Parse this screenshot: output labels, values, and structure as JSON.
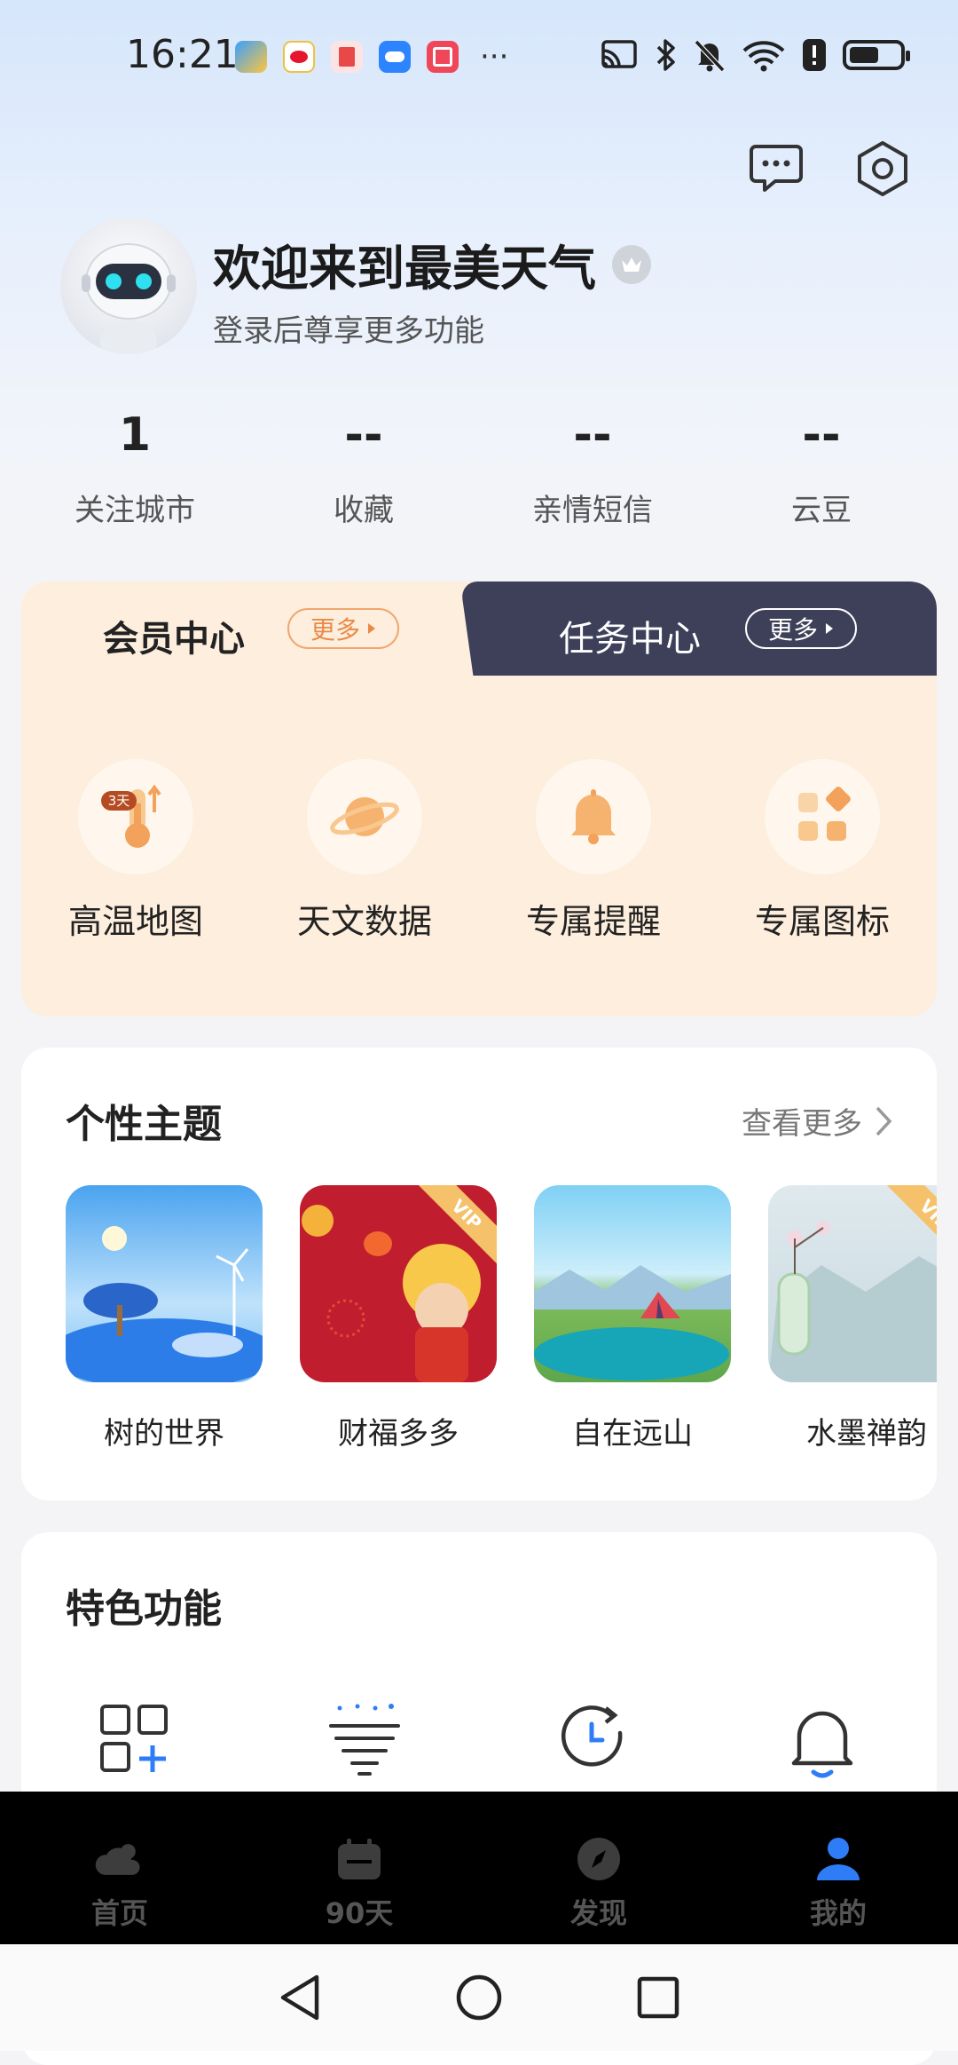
{
  "status_bar": {
    "time": "16:21",
    "more": "···",
    "notification_icons": [
      "weather-app-icon",
      "weibo-icon",
      "reader-app-icon",
      "cloud-app-icon",
      "gift-app-icon"
    ],
    "system_icons": [
      "cast-icon",
      "bluetooth-icon",
      "mute-icon",
      "wifi-icon",
      "alert-icon",
      "battery-icon"
    ]
  },
  "profile": {
    "welcome": "欢迎来到最美天气",
    "login_hint": "登录后尊享更多功能"
  },
  "stats": [
    {
      "value": "1",
      "label": "关注城市"
    },
    {
      "value": "--",
      "label": "收藏"
    },
    {
      "value": "--",
      "label": "亲情短信"
    },
    {
      "value": "--",
      "label": "云豆"
    }
  ],
  "member_card": {
    "member_tab": "会员中心",
    "member_more": "更多",
    "task_tab": "任务中心",
    "task_more": "更多",
    "badge": "3天",
    "items": [
      {
        "label": "高温地图",
        "icon": "thermometer-icon"
      },
      {
        "label": "天文数据",
        "icon": "planet-icon"
      },
      {
        "label": "专属提醒",
        "icon": "bell-icon"
      },
      {
        "label": "专属图标",
        "icon": "icon-grid-icon"
      }
    ]
  },
  "themes": {
    "title": "个性主题",
    "see_more": "查看更多",
    "vip_badge": "VIP",
    "items": [
      {
        "name": "树的世界"
      },
      {
        "name": "财福多多"
      },
      {
        "name": "自在远山"
      },
      {
        "name": "水墨禅韵"
      }
    ]
  },
  "features": {
    "title": "特色功能",
    "items": [
      "add-widget-icon",
      "tornado-icon",
      "history-clock-icon",
      "notification-bell-icon"
    ]
  },
  "bottom_nav": [
    {
      "label": "首页",
      "icon": "weather-home-icon"
    },
    {
      "label": "90天",
      "icon": "calendar-icon"
    },
    {
      "label": "发现",
      "icon": "compass-icon"
    },
    {
      "label": "我的",
      "icon": "user-icon"
    }
  ],
  "colors": {
    "accent_blue": "#2e7cf6",
    "member_bg": "#fdeedd",
    "task_tab_bg": "#3e4059",
    "orange": "#f2a25b"
  }
}
